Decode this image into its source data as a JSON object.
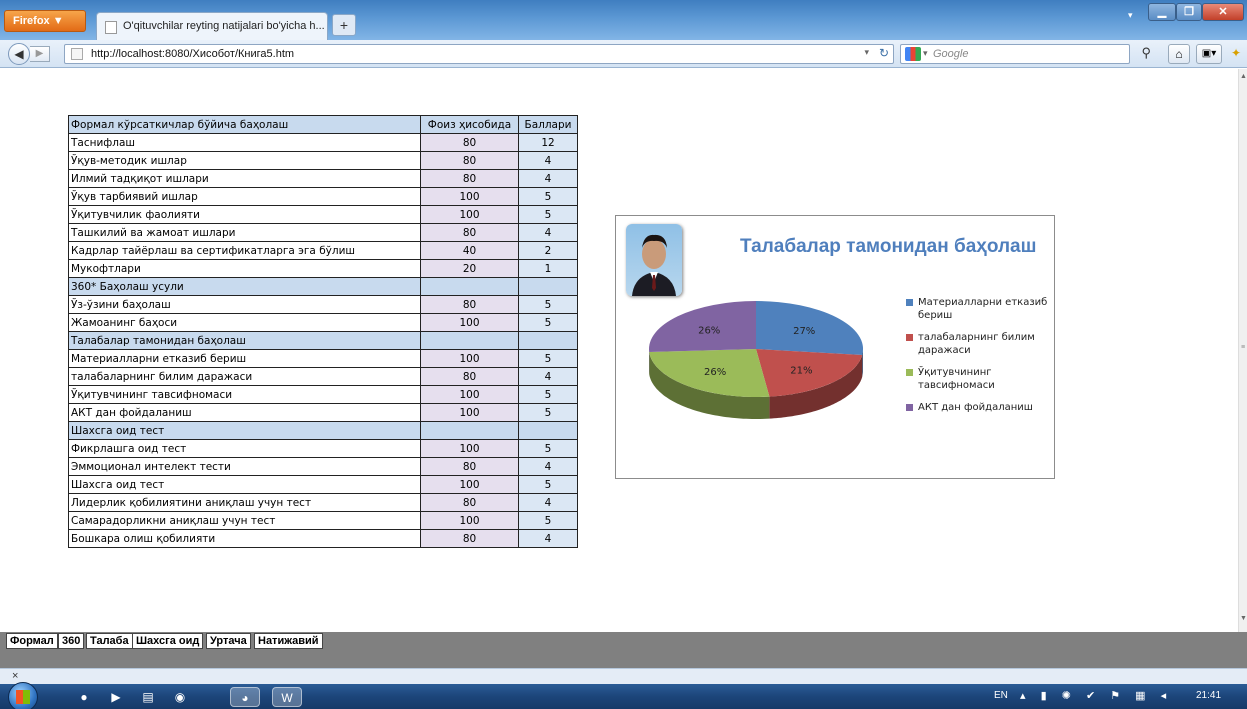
{
  "browser": {
    "menu_button_label": "Firefox ▼",
    "tab_title": "O'qituvchilar reyting natijalari bo'yicha h...",
    "tab_close": "×",
    "new_tab": "+",
    "url": "http://localhost:8080/Хисобот/Книга5.htm",
    "search_placeholder": "Google"
  },
  "table": {
    "header": [
      "Формал кўрсаткичлар бўйича баҳолаш",
      "Фоиз ҳисобида",
      "Баллари"
    ],
    "rows": [
      {
        "name": "Таснифлаш",
        "pct": "80",
        "pts": "12",
        "section": false
      },
      {
        "name": "Ўқув-методик ишлар",
        "pct": "80",
        "pts": "4",
        "section": false
      },
      {
        "name": "Илмий тадқиқот ишлари",
        "pct": "80",
        "pts": "4",
        "section": false
      },
      {
        "name": "Ўқув тарбиявий ишлар",
        "pct": "100",
        "pts": "5",
        "section": false
      },
      {
        "name": "Ўқитувчилик фаолияти",
        "pct": "100",
        "pts": "5",
        "section": false
      },
      {
        "name": "Ташкилий ва жамоат ишлари",
        "pct": "80",
        "pts": "4",
        "section": false
      },
      {
        "name": "Кадрлар тайёрлаш ва сертификатларга эга бўлиш",
        "pct": "40",
        "pts": "2",
        "section": false
      },
      {
        "name": "Мукофтлари",
        "pct": "20",
        "pts": "1",
        "section": false
      },
      {
        "name": "360* Баҳолаш усули",
        "pct": "",
        "pts": "",
        "section": true
      },
      {
        "name": "Ўз-ўзини баҳолаш",
        "pct": "80",
        "pts": "5",
        "section": false
      },
      {
        "name": "Жамоанинг баҳоси",
        "pct": "100",
        "pts": "5",
        "section": false
      },
      {
        "name": "Талабалар тамонидан баҳолаш",
        "pct": "",
        "pts": "",
        "section": true
      },
      {
        "name": "Материалларни етказиб бериш",
        "pct": "100",
        "pts": "5",
        "section": false
      },
      {
        "name": " талабаларнинг билим даражаси",
        "pct": "80",
        "pts": "4",
        "section": false
      },
      {
        "name": "Ўқитувчининг тавсифномаси",
        "pct": "100",
        "pts": "5",
        "section": false
      },
      {
        "name": "АКТ дан фойдаланиш",
        "pct": "100",
        "pts": "5",
        "section": false
      },
      {
        "name": "Шахсга оид тест",
        "pct": "",
        "pts": "",
        "section": true
      },
      {
        "name": "Фикрлашга оид  тест",
        "pct": "100",
        "pts": "5",
        "section": false
      },
      {
        "name": "Эммоционал интелект тести",
        "pct": "80",
        "pts": "4",
        "section": false
      },
      {
        "name": "Шахсга оид тест",
        "pct": "100",
        "pts": "5",
        "section": false
      },
      {
        "name": "Лидерлик қобилиятини аниқлаш учун тест",
        "pct": "80",
        "pts": "4",
        "section": false
      },
      {
        "name": "Самарадорликни аниқлаш учун тест",
        "pct": "100",
        "pts": "5",
        "section": false
      },
      {
        "name": "Бошкара олиш қобилияти",
        "pct": "80",
        "pts": "4",
        "section": false
      }
    ]
  },
  "chart_data": {
    "type": "pie",
    "title": "Талабалар тамонидан баҳолаш",
    "categories": [
      "Материалларни етказиб бериш",
      " талабаларнинг билим даражаси",
      "Ўқитувчининг тавсифномаси",
      "АКТ дан фойдаланиш"
    ],
    "values": [
      27,
      21,
      26,
      26
    ],
    "labels": [
      "27%",
      "21%",
      "26%",
      "26%"
    ],
    "colors": [
      "#4f81bd",
      "#c0504d",
      "#9bbb59",
      "#8064a2"
    ],
    "legend_position": "right",
    "style": "3d"
  },
  "sheet_tabs": [
    "Формал",
    "360",
    "Талаба",
    "Шахсга оид",
    "Уртача",
    "Натижавий"
  ],
  "taskbar": {
    "language": "EN",
    "time": "21:41"
  },
  "icons": {
    "back": "back-arrow-icon",
    "reload": "reload-icon",
    "home": "home-icon",
    "bookmarks": "bookmarks-icon",
    "search": "magnifier-icon"
  }
}
